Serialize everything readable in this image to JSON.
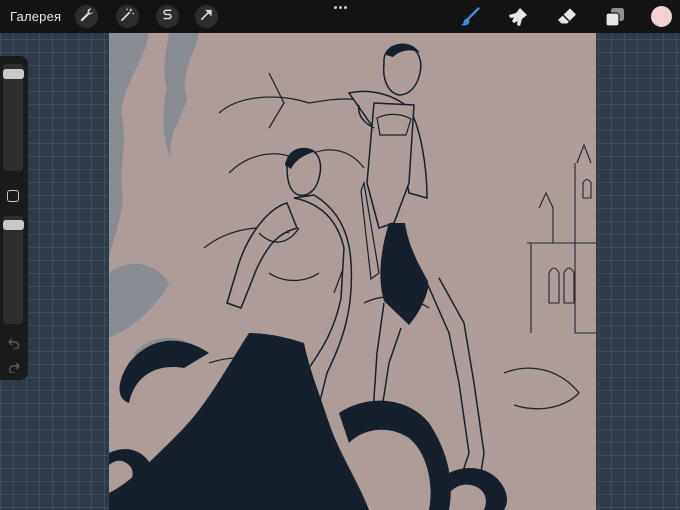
{
  "topbar": {
    "gallery_label": "Галерея",
    "left_tools": [
      {
        "name": "actions",
        "icon": "wrench-icon"
      },
      {
        "name": "adjustments",
        "icon": "magic-wand-icon"
      },
      {
        "name": "selection",
        "icon": "selection-s-icon"
      },
      {
        "name": "transform",
        "icon": "arrow-cursor-icon"
      }
    ],
    "right_tools": [
      {
        "name": "brush",
        "icon": "brush-icon",
        "active": true
      },
      {
        "name": "smudge",
        "icon": "smudge-icon",
        "active": false
      },
      {
        "name": "eraser",
        "icon": "eraser-icon",
        "active": false
      },
      {
        "name": "layers",
        "icon": "layers-icon",
        "active": false
      }
    ],
    "current_color": "#f6cfd3",
    "active_tool_color": "#3b8de0"
  },
  "sidebar": {
    "brush_size": 0.1,
    "brush_opacity": 0.05
  },
  "canvas": {
    "background_color": "#ad9c98",
    "ink_color": "#16202c",
    "rock_color": "#8a8c93"
  }
}
